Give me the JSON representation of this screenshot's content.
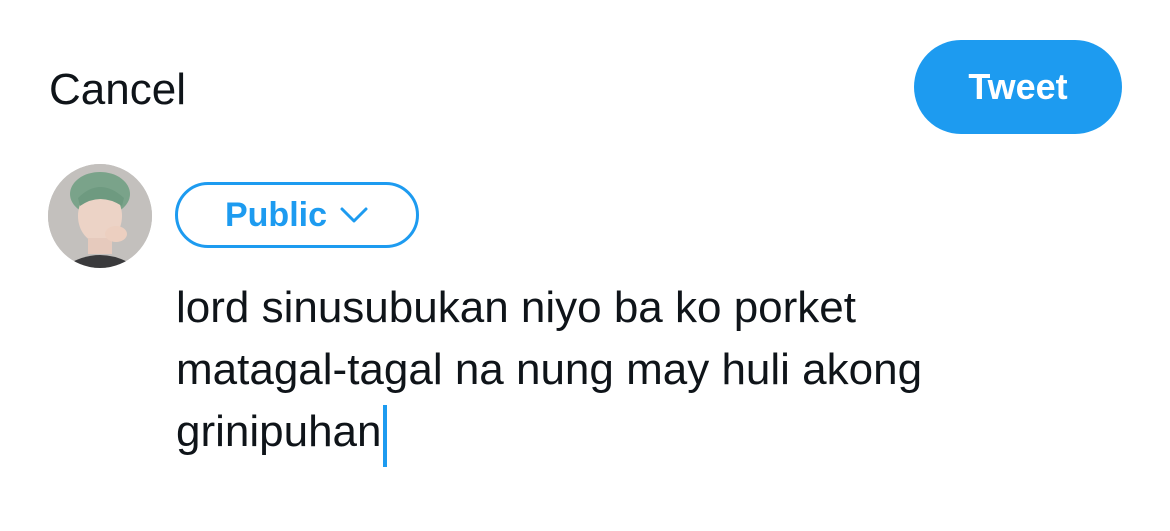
{
  "header": {
    "cancel_label": "Cancel",
    "tweet_label": "Tweet"
  },
  "composer": {
    "audience_label": "Public",
    "audience_icon": "chevron-down-icon",
    "text_lines": [
      "lord sinusubukan niyo ba ko porket",
      "matagal-tagal na nung may huli akong",
      "grinipuhan"
    ]
  },
  "colors": {
    "accent": "#1d9bf0",
    "text": "#0f1419",
    "background": "#ffffff"
  }
}
